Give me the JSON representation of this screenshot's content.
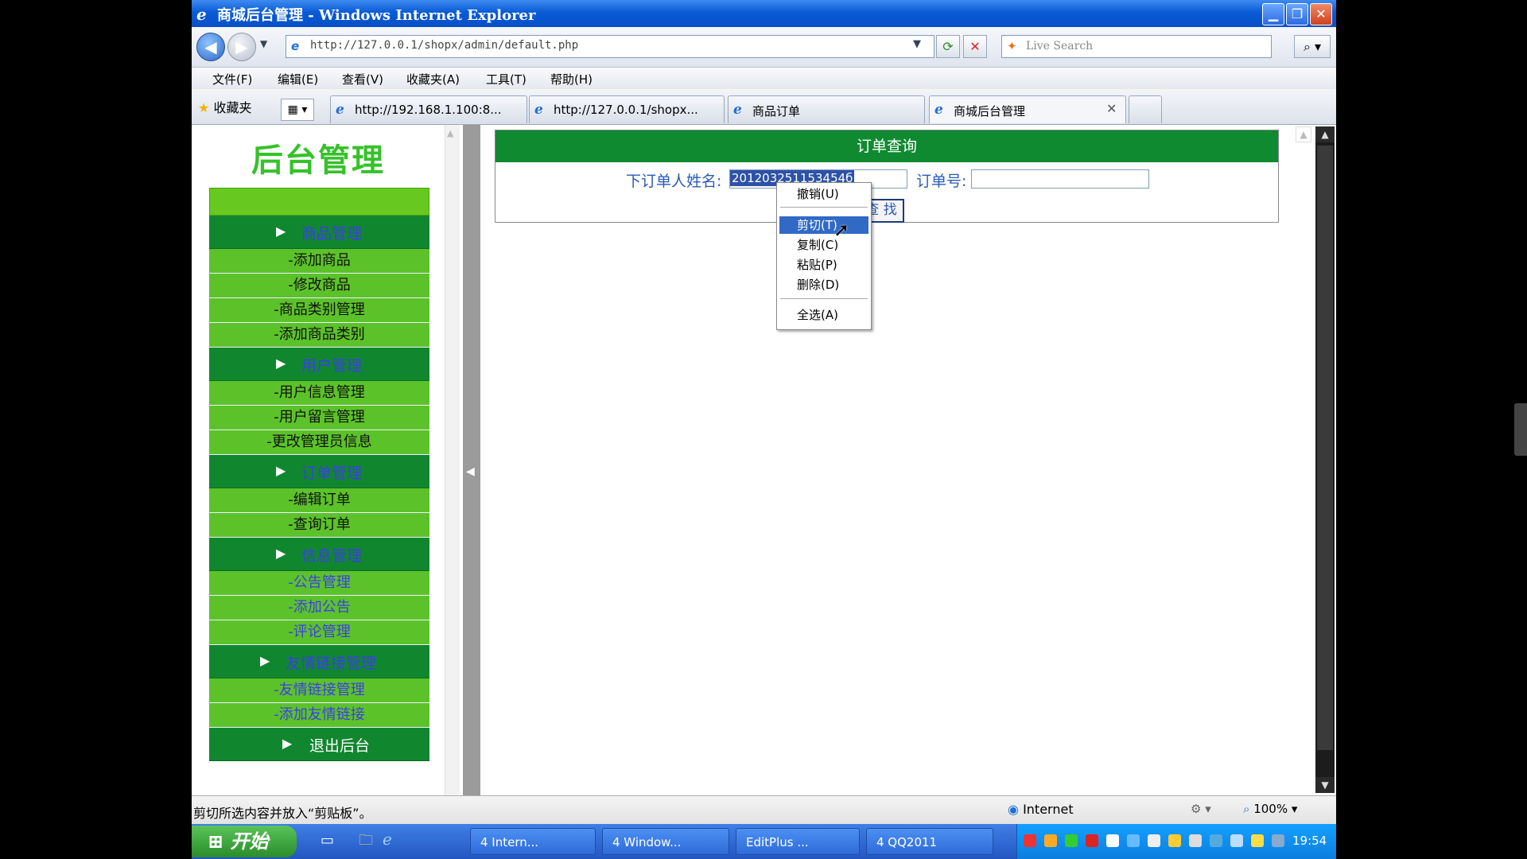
{
  "window": {
    "title": "商城后台管理 - Windows Internet Explorer"
  },
  "address_bar": {
    "url": "http://127.0.0.1/shopx/admin/default.php",
    "search_placeholder": "Live Search"
  },
  "menu": [
    "文件(F)",
    "编辑(E)",
    "查看(V)",
    "收藏夹(A)",
    "工具(T)",
    "帮助(H)"
  ],
  "favorites_label": "收藏夹",
  "tabs": [
    {
      "label": "http://192.168.1.100:8..."
    },
    {
      "label": "http://127.0.0.1/shopx..."
    },
    {
      "label": "商品订单"
    },
    {
      "label": "商城后台管理",
      "active": true
    }
  ],
  "sidebar": {
    "brand": "后台管理",
    "sections": [
      {
        "title": "商品管理",
        "items": [
          "-添加商品",
          "-修改商品",
          "-商品类别管理",
          "-添加商品类别"
        ]
      },
      {
        "title": "用户管理",
        "items": [
          "-用户信息管理",
          "-用户留言管理",
          "-更改管理员信息"
        ]
      },
      {
        "title": "订单管理",
        "items": [
          "-编辑订单",
          "-查询订单"
        ]
      },
      {
        "title": "信息管理",
        "items": [
          "-公告管理",
          "-添加公告",
          "-评论管理"
        ]
      },
      {
        "title": "友情链接管理",
        "items": [
          "-友情链接管理",
          "-添加友情链接"
        ]
      }
    ],
    "logout": "退出后台"
  },
  "order_query": {
    "heading": "订单查询",
    "name_label": "下订单人姓名:",
    "name_value": "201203251153454б",
    "order_no_label": "订单号:",
    "order_no_value": "",
    "find_button": "查 找"
  },
  "context_menu": {
    "items": [
      "撤销(U)",
      "剪切(T)",
      "复制(C)",
      "粘贴(P)",
      "删除(D)",
      "全选(A)"
    ],
    "highlighted": "剪切(T)"
  },
  "status_bar": {
    "text": "剪切所选内容并放入“剪贴板”。",
    "zone": "Internet",
    "zoom": "100%"
  },
  "taskbar": {
    "start": "开始",
    "tasks": [
      "4 Intern...",
      "4 Window...",
      "EditPlus ...",
      "4 QQ2011"
    ],
    "clock": "19:54"
  },
  "colors": {
    "header_green": "#0f8a30",
    "menu_green": "#5cc22a",
    "selection_blue": "#316ac5"
  }
}
